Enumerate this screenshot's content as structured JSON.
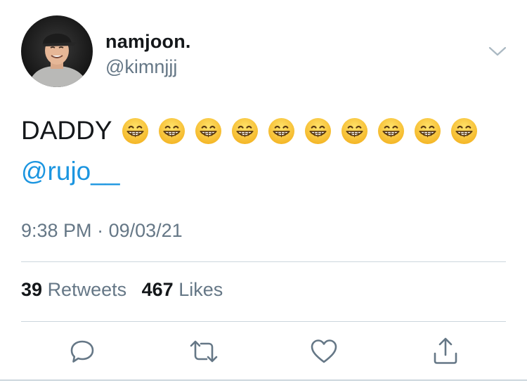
{
  "user": {
    "display_name": "namjoon.",
    "handle": "@kimnjjj"
  },
  "tweet": {
    "text": "DADDY",
    "emoji_count": 10,
    "emoji_icon": "grinning-face-with-smiling-eyes",
    "mention": "@rujo__"
  },
  "meta": {
    "time": "9:38 PM",
    "separator": "·",
    "date": "09/03/21"
  },
  "stats": {
    "retweets_count": "39",
    "retweets_label": "Retweets",
    "likes_count": "467",
    "likes_label": "Likes"
  },
  "actions": [
    {
      "icon": "reply-icon"
    },
    {
      "icon": "retweet-icon"
    },
    {
      "icon": "like-icon"
    },
    {
      "icon": "share-icon"
    }
  ],
  "colors": {
    "text": "#14171a",
    "secondary": "#657786",
    "link": "#1b95e0",
    "divider": "#ccd6dd"
  }
}
